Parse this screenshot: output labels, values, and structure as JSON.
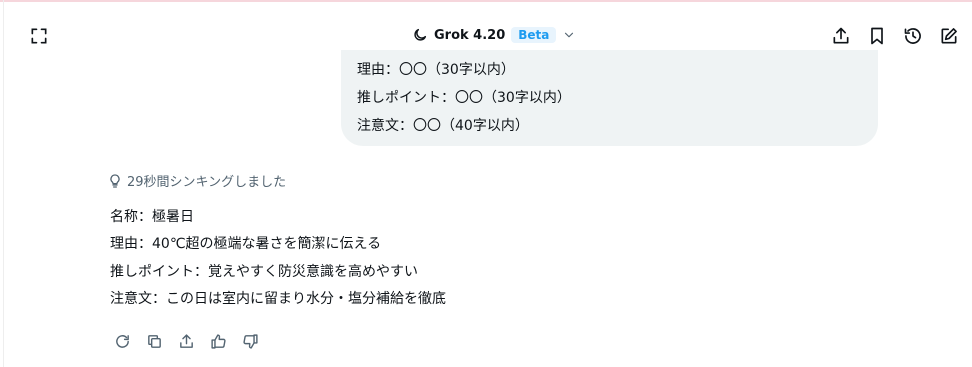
{
  "header": {
    "model_name": "Grok 4.20",
    "beta_label": "Beta",
    "icons": {
      "expand": "expand-icon",
      "model": "moon-icon",
      "dropdown": "chevron-down-icon",
      "share": "share-icon",
      "bookmark": "bookmark-icon",
      "history": "history-icon",
      "new_chat": "edit-icon"
    }
  },
  "user_message": {
    "lines": [
      "理由：〇〇（30字以内）",
      "推しポイント：〇〇（30字以内）",
      "注意文：〇〇（40字以内）"
    ]
  },
  "assistant_message": {
    "thinking_label": "29秒間シンキングしました",
    "lines": [
      "名称：極暑日",
      "理由：40℃超の極端な暑さを簡潔に伝える",
      "推しポイント：覚えやすく防災意識を高めやすい",
      "注意文：この日は室内に留まり水分・塩分補給を徹底"
    ],
    "actions": [
      "regenerate-icon",
      "copy-icon",
      "share-icon",
      "thumbs-up-icon",
      "thumbs-down-icon"
    ]
  },
  "colors": {
    "bubble_bg": "#eff3f4",
    "text": "#0f1419",
    "muted": "#536471",
    "accent": "#1d9bf0"
  }
}
